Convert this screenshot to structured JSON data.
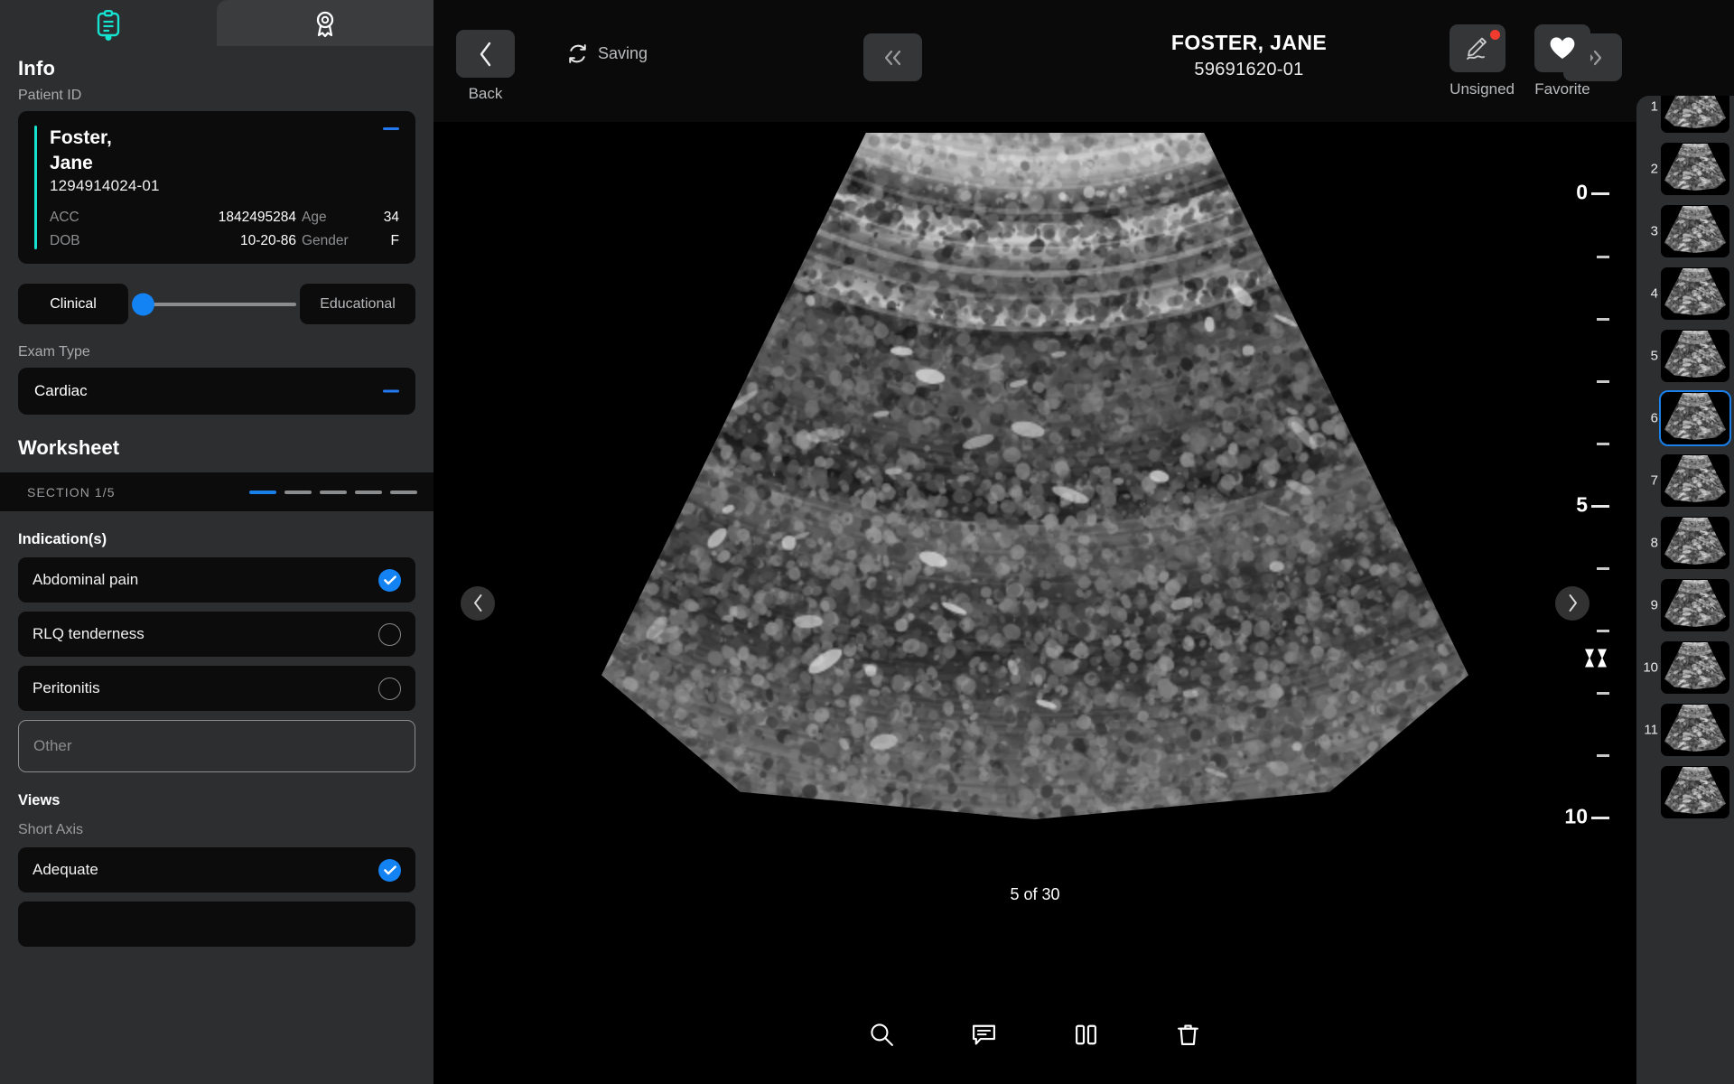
{
  "left_panel": {
    "tabs": [
      {
        "name": "worksheet-tab",
        "icon": "clipboard-icon",
        "active": true
      },
      {
        "name": "credential-tab",
        "icon": "award-badge-icon",
        "active": false
      }
    ],
    "info_heading": "Info",
    "patient_id_label": "Patient ID",
    "patient_card": {
      "name_line1": "Foster,",
      "name_line2": "Jane",
      "id": "1294914024-01",
      "acc_label": "ACC",
      "acc_value": "1842495284",
      "dob_label": "DOB",
      "dob_value": "10-20-86",
      "age_label": "Age",
      "age_value": "34",
      "gender_label": "Gender",
      "gender_value": "F",
      "collapse_icon": "minus-icon",
      "accent_color": "#15e3d0"
    },
    "mode_toggle": {
      "left_label": "Clinical",
      "right_label": "Educational",
      "selected": "Clinical",
      "knob_color": "#1383f4"
    },
    "exam_type_label": "Exam Type",
    "exam_type_value": "Cardiac",
    "worksheet_heading": "Worksheet",
    "section_label": "SECTION 1/5",
    "section_total": 5,
    "section_current": 1,
    "indications_heading": "Indication(s)",
    "indications": [
      {
        "label": "Abdominal pain",
        "checked": true
      },
      {
        "label": "RLQ tenderness",
        "checked": false
      },
      {
        "label": "Peritonitis",
        "checked": false
      }
    ],
    "other_placeholder": "Other",
    "other_value": "",
    "views_heading": "Views",
    "views_subheading": "Short Axis",
    "views_options": [
      {
        "label": "Adequate",
        "checked": true
      }
    ]
  },
  "topbar": {
    "back_label": "Back",
    "back_icon": "chevron-left-icon",
    "saving_text": "Saving",
    "saving_icon": "sync-icon",
    "prev_icon": "double-chevron-left-icon",
    "next_icon": "double-chevron-right-icon",
    "patient_name": "FOSTER, JANE",
    "patient_accession": "59691620-01",
    "actions": [
      {
        "label": "Unsigned",
        "icon": "signature-pen-icon",
        "badge": true,
        "badge_color": "#f03b2e"
      },
      {
        "label": "Favorite",
        "icon": "heart-filled-icon",
        "badge": false
      }
    ]
  },
  "viewer": {
    "prev_frame_icon": "chevron-left-icon",
    "next_frame_icon": "chevron-right-icon",
    "frame_counter": "5 of 30",
    "depth_unit": "cm",
    "ruler_labels": [
      "0",
      "5",
      "10"
    ],
    "focus_marker_icon": "hourglass-focus-icon",
    "tools": [
      {
        "name": "zoom-tool",
        "icon": "magnifier-icon"
      },
      {
        "name": "annotate-tool",
        "icon": "comment-bubble-icon"
      },
      {
        "name": "compare-tool",
        "icon": "split-pane-icon"
      },
      {
        "name": "delete-tool",
        "icon": "trash-icon"
      }
    ]
  },
  "thumbnail_rail": {
    "selected_index": 6,
    "selected_color": "#1a7fe8",
    "items": [
      {
        "number": "1"
      },
      {
        "number": "2"
      },
      {
        "number": "3"
      },
      {
        "number": "4"
      },
      {
        "number": "5"
      },
      {
        "number": "6"
      },
      {
        "number": "7"
      },
      {
        "number": "8"
      },
      {
        "number": "9"
      },
      {
        "number": "10"
      },
      {
        "number": "11"
      },
      {
        "number": ""
      }
    ]
  }
}
